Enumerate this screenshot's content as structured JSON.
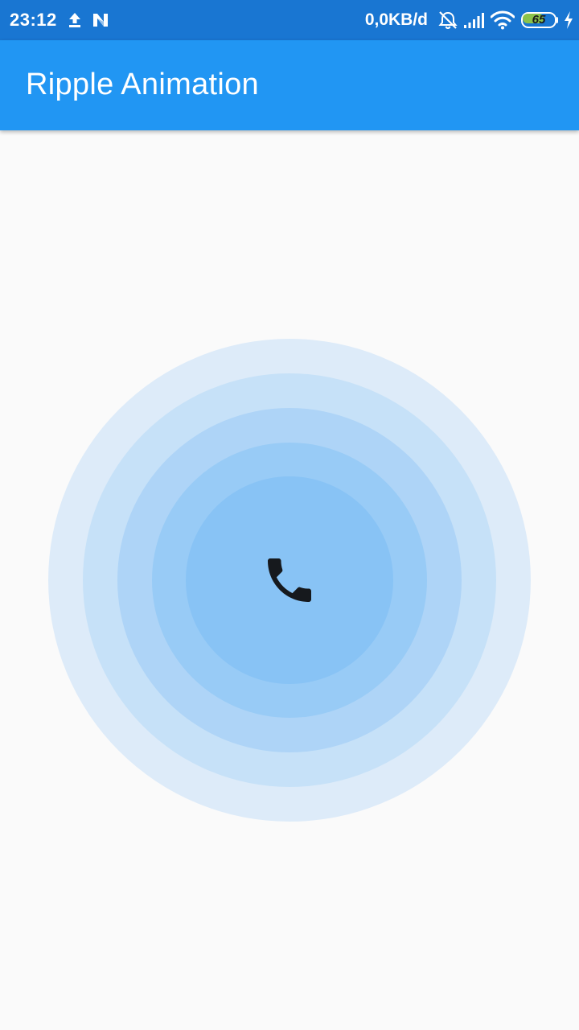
{
  "status_bar": {
    "time": "23:12",
    "left_icons": [
      "upload-icon",
      "n-notification-icon"
    ],
    "network_speed": "0,0KB/d",
    "right_icons": [
      "alarm-off-icon",
      "signal-icon",
      "wifi-icon",
      "charging-icon"
    ],
    "battery_level": "65",
    "battery_fraction": 0.65,
    "background_color": "#1976d2"
  },
  "app_bar": {
    "title": "Ripple Animation",
    "background_color": "#2196f3"
  },
  "ripple": {
    "center_icon": "phone-icon",
    "ring_colors": [
      "#ddebf9",
      "#c6e1f8",
      "#aed4f7",
      "#98cbf6",
      "#88c3f5"
    ],
    "icon_color": "#16191d"
  }
}
